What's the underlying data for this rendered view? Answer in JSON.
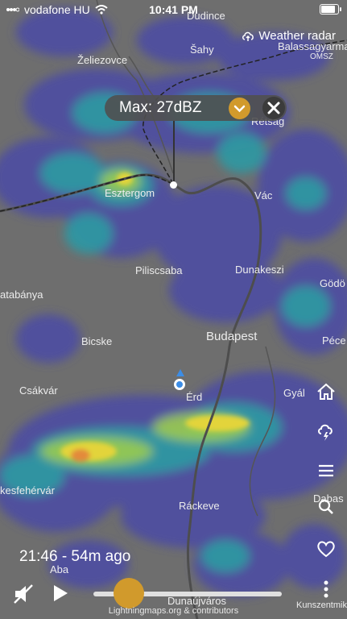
{
  "status_bar": {
    "carrier": "vodafone HU",
    "time": "10:41 PM",
    "battery_percent": 0.85
  },
  "radar_title": "Weather radar",
  "max_box": {
    "label": "Max: 27dBZ"
  },
  "map": {
    "cities": {
      "dudince": "Dudince",
      "zeliezovce": "Želiezovce",
      "sahy": "Šahy",
      "balassagyarmat": "Balassagyarmat",
      "omsz": "OMSZ",
      "retsag": "Rétság",
      "esztergom": "Esztergom",
      "vac": "Vác",
      "piliscsaba": "Piliscsaba",
      "dunakeszi": "Dunakeszi",
      "tatabanya": "atabánya",
      "godollo": "Gödö",
      "budapest": "Budapest",
      "bicske": "Bicske",
      "pecel": "Péce",
      "csakvar": "Csákvár",
      "erd": "Érd",
      "gyal": "Gyál",
      "szekesfehervar": "kesfehérvár",
      "rackeve": "Ráckeve",
      "dabas": "Dabas",
      "aba": "Aba",
      "dunaujvaros": "Dunaújváros",
      "kunszentmiklos": "Kunszentmiklós"
    }
  },
  "timeline": {
    "time_text": "21:46 - 54m ago",
    "position": 0.19
  },
  "credit": "Lightningmaps.org & contributors",
  "icons": {
    "home": "home-icon",
    "storm": "storm-icon",
    "menu": "menu-icon",
    "search": "search-icon",
    "favorite": "heart-icon",
    "more": "more-icon",
    "mute": "mute-icon",
    "play": "play-icon",
    "chevron": "chevron-down-icon",
    "close": "close-icon"
  },
  "colors": {
    "accent": "#d19a2c",
    "radar_weak": "#4c4ca8",
    "radar_mid": "#2fa0a0",
    "radar_high": "#e6dc3c"
  }
}
